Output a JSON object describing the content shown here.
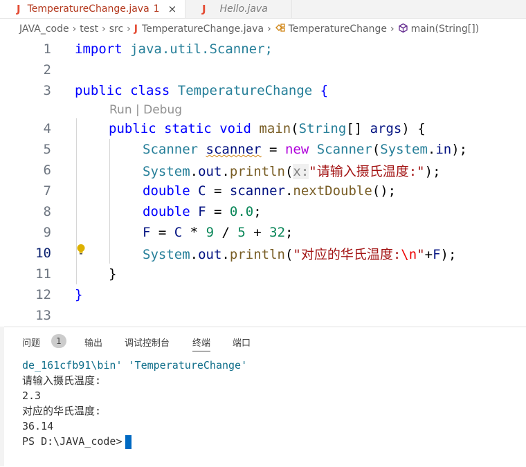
{
  "tabs": [
    {
      "icon": "J",
      "name": "TemperatureChange.java",
      "problems": "1",
      "close": "×"
    },
    {
      "icon": "J",
      "name": "Hello.java"
    }
  ],
  "breadcrumb": {
    "items": [
      "JAVA_code",
      "test",
      "src",
      "TemperatureChange.java",
      "TemperatureChange",
      "main(String[])"
    ],
    "separator": "›"
  },
  "editor": {
    "codelens": "Run | Debug",
    "line_numbers": [
      "1",
      "2",
      "3",
      "4",
      "5",
      "6",
      "7",
      "8",
      "9",
      "10",
      "11",
      "12",
      "13"
    ],
    "lines": {
      "l1": {
        "kw": "import",
        "rest": "java.util.Scanner;"
      },
      "l3": {
        "kw1": "public",
        "kw2": "class",
        "cls": "TemperatureChange",
        "brace": "{"
      },
      "l4": {
        "kw1": "public",
        "kw2": "static",
        "kw3": "void",
        "fn": "main",
        "p1": "(",
        "ty": "String",
        "arr": "[] ",
        "arg": "args",
        "p2": ") {"
      },
      "l5": {
        "ty": "Scanner",
        "var": "scanner",
        "eq": " = ",
        "kw": "new",
        "ty2": "Scanner",
        "p1": "(",
        "sys": "System",
        "dot": ".",
        "in": "in",
        "end": ");"
      },
      "l6": {
        "sys": "System",
        "dot1": ".",
        "out": "out",
        "dot2": ".",
        "fn": "println",
        "p1": "(",
        "hint": "x:",
        "str": "\"请输入摄氏温度:\"",
        "end": ");"
      },
      "l7": {
        "kw": "double",
        "var": "C",
        "eq": " = ",
        "obj": "scanner",
        "dot": ".",
        "fn": "nextDouble",
        "end": "();"
      },
      "l8": {
        "kw": "double",
        "var": "F",
        "eq": " = ",
        "num": "0.0",
        "end": ";"
      },
      "l9": {
        "v1": "F",
        "eq": " = ",
        "v2": "C",
        "op1": " * ",
        "n1": "9",
        "op2": " / ",
        "n2": "5",
        "op3": " + ",
        "n3": "32",
        "end": ";"
      },
      "l10": {
        "sys": "System",
        "dot1": ".",
        "out": "out",
        "dot2": ".",
        "fn": "println",
        "p1": "(",
        "str1": "\"对应的华氏温度:",
        "esc": "\\n",
        "str2": "\"",
        "plus": "+",
        "var": "F",
        "end": ");"
      },
      "l11": {
        "brace": "}"
      },
      "l12": {
        "brace": "}"
      }
    }
  },
  "panel": {
    "tabs": [
      "问题",
      "输出",
      "调试控制台",
      "终端",
      "端口"
    ],
    "problems_count": "1",
    "active_tab": "终端",
    "terminal": {
      "line1": "de_161cfb91\\bin' 'TemperatureChange'",
      "line2": "请输入摄氏温度:",
      "line3": "2.3",
      "line4": "对应的华氏温度:",
      "line5": "36.14",
      "prompt": "PS D:\\JAVA_code>"
    }
  },
  "colors": {
    "keyword": "#0000ff",
    "type": "#267f99",
    "string": "#a31515",
    "number": "#098658",
    "accent": "#0069c2"
  }
}
